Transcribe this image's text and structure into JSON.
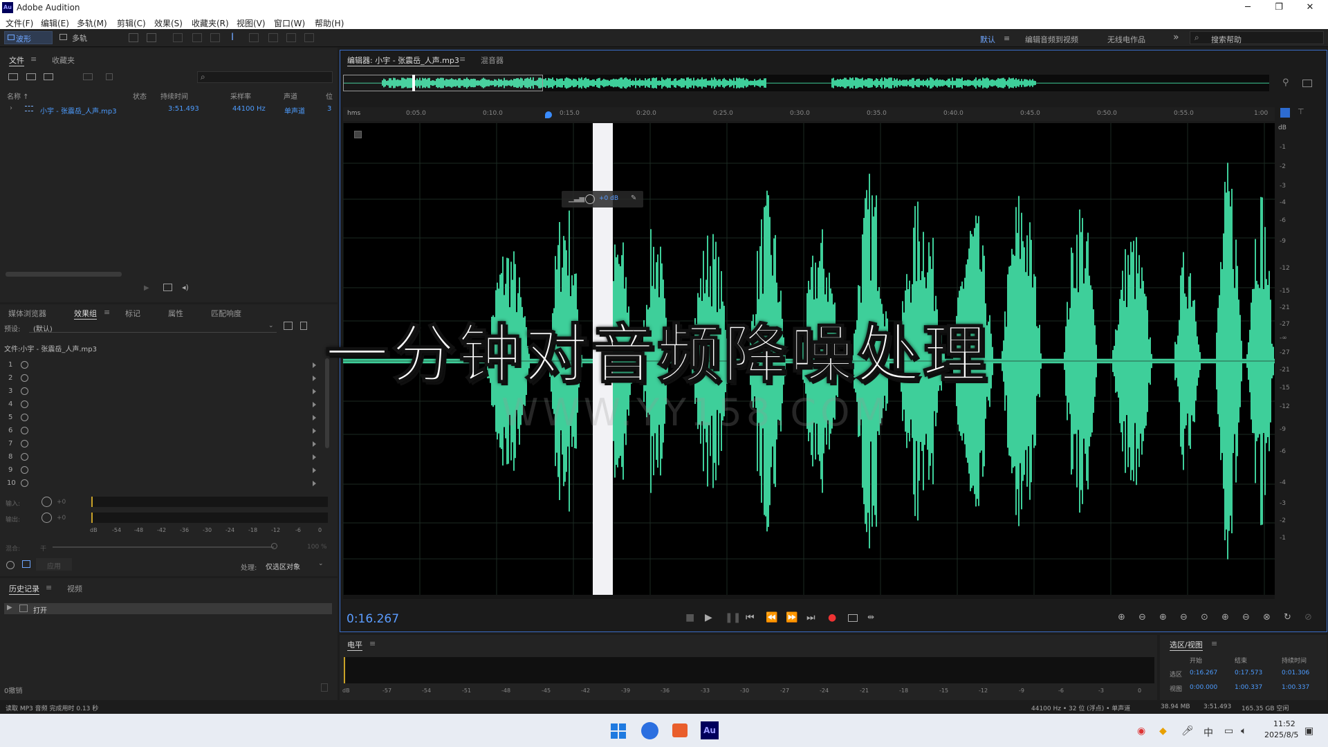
{
  "app": {
    "title": "Adobe Audition",
    "logo": "Au"
  },
  "window_controls": {
    "minimize": "─",
    "maximize": "❐",
    "close": "✕"
  },
  "menu": [
    "文件(F)",
    "编辑(E)",
    "多轨(M)",
    "剪辑(C)",
    "效果(S)",
    "收藏夹(R)",
    "视图(V)",
    "窗口(W)",
    "帮助(H)"
  ],
  "toolbar": {
    "waveform": "波形",
    "multitrack": "多轨"
  },
  "workspaces": {
    "default": "默认",
    "edit_video": "编辑音频到视频",
    "radio": "无线电作品",
    "more": "»",
    "search_placeholder": "搜索帮助"
  },
  "files_panel": {
    "tabs": [
      "文件",
      "收藏夹"
    ],
    "columns": [
      "名称 ↑",
      "状态",
      "持续时间",
      "采样率",
      "声道",
      "位"
    ],
    "file": {
      "name": "小宇 - 张震岳_人声.mp3",
      "duration": "3:51.493",
      "sample_rate": "44100 Hz",
      "channels": "单声道",
      "bits": "3"
    }
  },
  "effects_panel": {
    "tabs": [
      "媒体浏览器",
      "效果组",
      "标记",
      "属性",
      "匹配响度"
    ],
    "preset_label": "预设:",
    "preset_value": "(默认)",
    "file_label": "文件:小宇 - 张震岳_人声.mp3",
    "rows": [
      "1",
      "2",
      "3",
      "4",
      "5",
      "6",
      "7",
      "8",
      "9",
      "10"
    ],
    "input_label": "输入:",
    "output_label": "输出:",
    "gain_zero": "+0",
    "meter_scale": [
      "dB",
      "-54",
      "-48",
      "-42",
      "-36",
      "-30",
      "-24",
      "-18",
      "-12",
      "-6",
      "0"
    ],
    "mix_label": "混合:",
    "mix_dry": "干",
    "mix_value": "100 %",
    "apply_label": "应用",
    "process_label": "处理:",
    "process_value": "仅选区对象"
  },
  "history_panel": {
    "tabs": [
      "历史记录",
      "视频"
    ],
    "item": "打开",
    "undo": "0撤销"
  },
  "editor": {
    "tabs": [
      "编辑器: 小宇 - 张震岳_人声.mp3",
      "混音器"
    ],
    "ruler_unit": "hms",
    "ruler_ticks": [
      "0:05.0",
      "0:10.0",
      "0:15.0",
      "0:20.0",
      "0:25.0",
      "0:30.0",
      "0:35.0",
      "0:40.0",
      "0:45.0",
      "0:50.0",
      "0:55.0",
      "1:00"
    ],
    "db_unit": "dB",
    "db_scale": [
      "-1",
      "-2",
      "-3",
      "-4",
      "-6",
      "-9",
      "-12",
      "-15",
      "-21",
      "-27",
      "-∞",
      "-27",
      "-21",
      "-15",
      "-12",
      "-9",
      "-6",
      "-4",
      "-3",
      "-2",
      "-1"
    ],
    "hud_gain": "+0 dB",
    "current_time": "0:16.267",
    "waveform_color": "#3ecf9a",
    "selection_color": "#ffffff"
  },
  "overlay": {
    "title": "一分钟对音频降噪处理",
    "watermark": "WWW.YY158.COM"
  },
  "level_panel": {
    "title": "电平",
    "scale": [
      "dB",
      "-57",
      "-54",
      "-51",
      "-48",
      "-45",
      "-42",
      "-39",
      "-36",
      "-33",
      "-30",
      "-27",
      "-24",
      "-21",
      "-18",
      "-15",
      "-12",
      "-9",
      "-6",
      "-3",
      "0"
    ]
  },
  "selection_view": {
    "title": "选区/视图",
    "headers": [
      "开始",
      "结束",
      "持续时间"
    ],
    "rows": [
      {
        "label": "选区",
        "start": "0:16.267",
        "end": "0:17.573",
        "duration": "0:01.306"
      },
      {
        "label": "视图",
        "start": "0:00.000",
        "end": "1:00.337",
        "duration": "1:00.337"
      }
    ]
  },
  "status": {
    "left": "读取 MP3 音频 完成用时 0.13 秒",
    "format": "44100 Hz • 32 位 (浮点) • 单声道",
    "size": "38.94 MB",
    "duration": "3:51.493",
    "free": "165.35 GB 空闲"
  },
  "taskbar": {
    "time": "11:52",
    "date": "2025/8/5",
    "ime": "中"
  }
}
